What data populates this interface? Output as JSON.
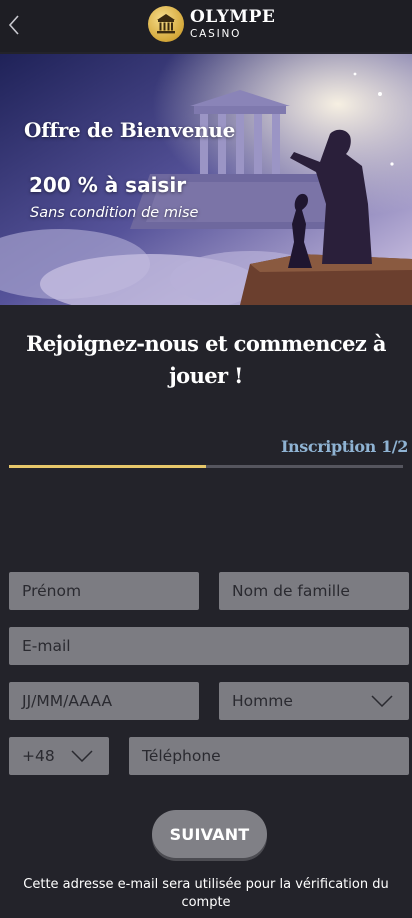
{
  "header": {
    "brand_name": "OLYMPE",
    "brand_sub": "CASINO",
    "back_icon": "chevron-left-icon",
    "logo_icon": "temple-icon"
  },
  "banner": {
    "title": "Offre de Bienvenue",
    "amount": "200 % à saisir",
    "subtitle": "Sans condition de mise"
  },
  "form": {
    "heading": "Rejoignez-nous et commencez à jouer !",
    "step_label": "Inscription 1/2",
    "progress": 0.5,
    "first_name_placeholder": "Prénom",
    "last_name_placeholder": "Nom de famille",
    "email_placeholder": "E-mail",
    "dob_placeholder": "JJ/MM/AAAA",
    "gender_value": "Homme",
    "phone_code_value": "+48",
    "phone_placeholder": "Téléphone",
    "next_label": "SUIVANT",
    "note": "Cette adresse e-mail sera utilisée pour la vérification du compte"
  },
  "colors": {
    "background": "#23232a",
    "accent": "#e6c76a",
    "step_label": "#8fb3d3",
    "field_bg": "#7c7c82"
  }
}
